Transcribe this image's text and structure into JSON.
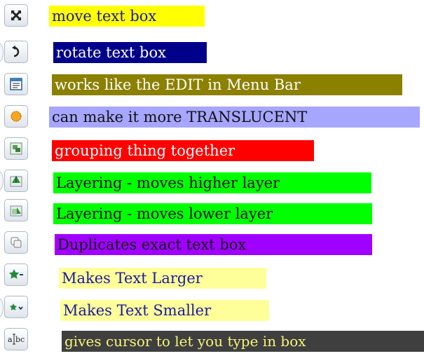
{
  "items": [
    {
      "icon": "move-icon",
      "label": "move text box",
      "bg": "#ffff00",
      "fg": "#1a1aa0"
    },
    {
      "icon": "rotate-icon",
      "label": "rotate text box",
      "bg": "#00008b",
      "fg": "#ffffff"
    },
    {
      "icon": "edit-icon",
      "label": "works like the EDIT in Menu Bar",
      "bg": "#8b8000",
      "fg": "#ffffff"
    },
    {
      "icon": "translucent-icon",
      "label": "can make it more TRANSLUCENT",
      "bg": "#a6a6ff",
      "fg": "#111111"
    },
    {
      "icon": "group-icon",
      "label": "grouping thing together",
      "bg": "#ff0000",
      "fg": "#ffffff"
    },
    {
      "icon": "layer-up-icon",
      "label": "Layering - moves higher layer",
      "bg": "#00ff00",
      "fg": "#111111"
    },
    {
      "icon": "layer-down-icon",
      "label": "Layering - moves lower layer",
      "bg": "#00ff00",
      "fg": "#111111"
    },
    {
      "icon": "duplicate-icon",
      "label": "Duplicates exact text box",
      "bg": "#a000ff",
      "fg": "#111111"
    },
    {
      "icon": "text-larger-icon",
      "label": "Makes Text Larger",
      "bg": "#ffff99",
      "fg": "#1a1aa0"
    },
    {
      "icon": "text-smaller-icon",
      "label": "Makes Text Smaller",
      "bg": "#ffff99",
      "fg": "#1a1aa0"
    },
    {
      "icon": "type-cursor-icon",
      "label": "gives cursor to let you type in box",
      "bg": "#3f3f3f",
      "fg": "#f5f57a"
    }
  ]
}
